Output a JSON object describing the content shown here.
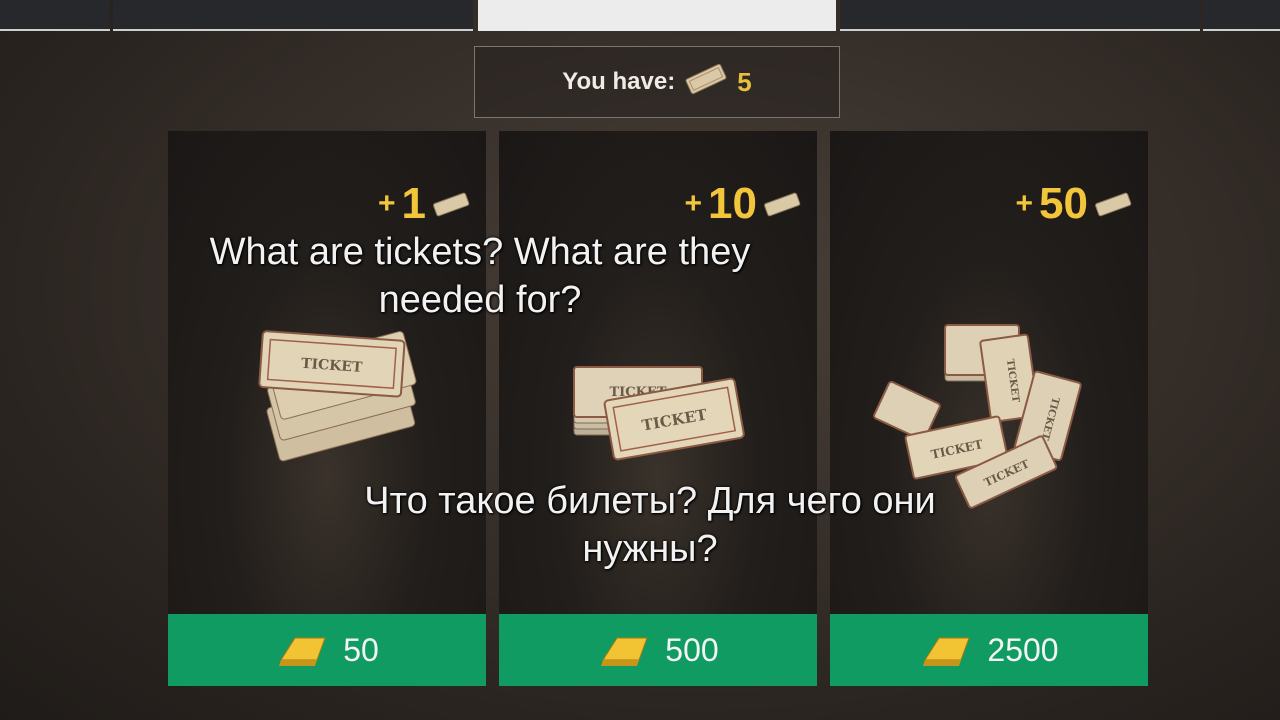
{
  "header": {
    "you_have_label": "You have:",
    "you_have_count": "5"
  },
  "packs": [
    {
      "plus": "+",
      "amount": "1",
      "price": "50"
    },
    {
      "plus": "+",
      "amount": "10",
      "price": "500"
    },
    {
      "plus": "+",
      "amount": "50",
      "price": "2500"
    }
  ],
  "captions": {
    "english": "What are tickets? What are they needed for?",
    "russian": "Что такое билеты? Для чего они нужны?"
  },
  "colors": {
    "buy_button": "#109b62",
    "amount": "#f3c53b"
  },
  "icons": {
    "currency": "ticket-icon",
    "price": "gold-bar-icon"
  }
}
